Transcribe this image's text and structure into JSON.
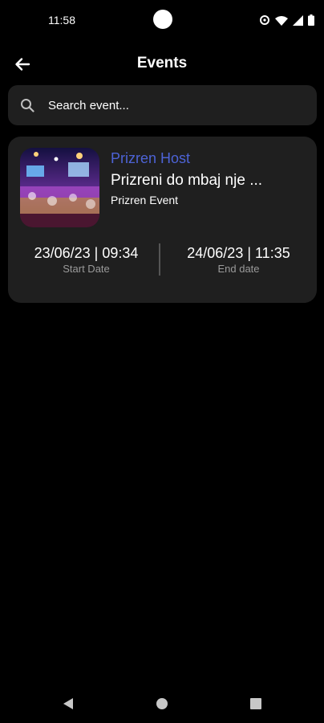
{
  "status_bar": {
    "time": "11:58"
  },
  "app_bar": {
    "title": "Events",
    "back_icon": "arrow-left-icon"
  },
  "search": {
    "placeholder": "Search event...",
    "value": "",
    "icon": "search-icon"
  },
  "events": [
    {
      "host": "Prizren Host",
      "title": "Prizreni do mbaj nje ...",
      "category": "Prizren Event",
      "start_date": "23/06/23 | 09:34",
      "start_label": "Start Date",
      "end_date": "24/06/23 | 11:35",
      "end_label": "End date"
    }
  ],
  "colors": {
    "background": "#000000",
    "card": "#1f1f1f",
    "host_accent": "#4d63d6",
    "muted_label": "#9a9a9a"
  }
}
